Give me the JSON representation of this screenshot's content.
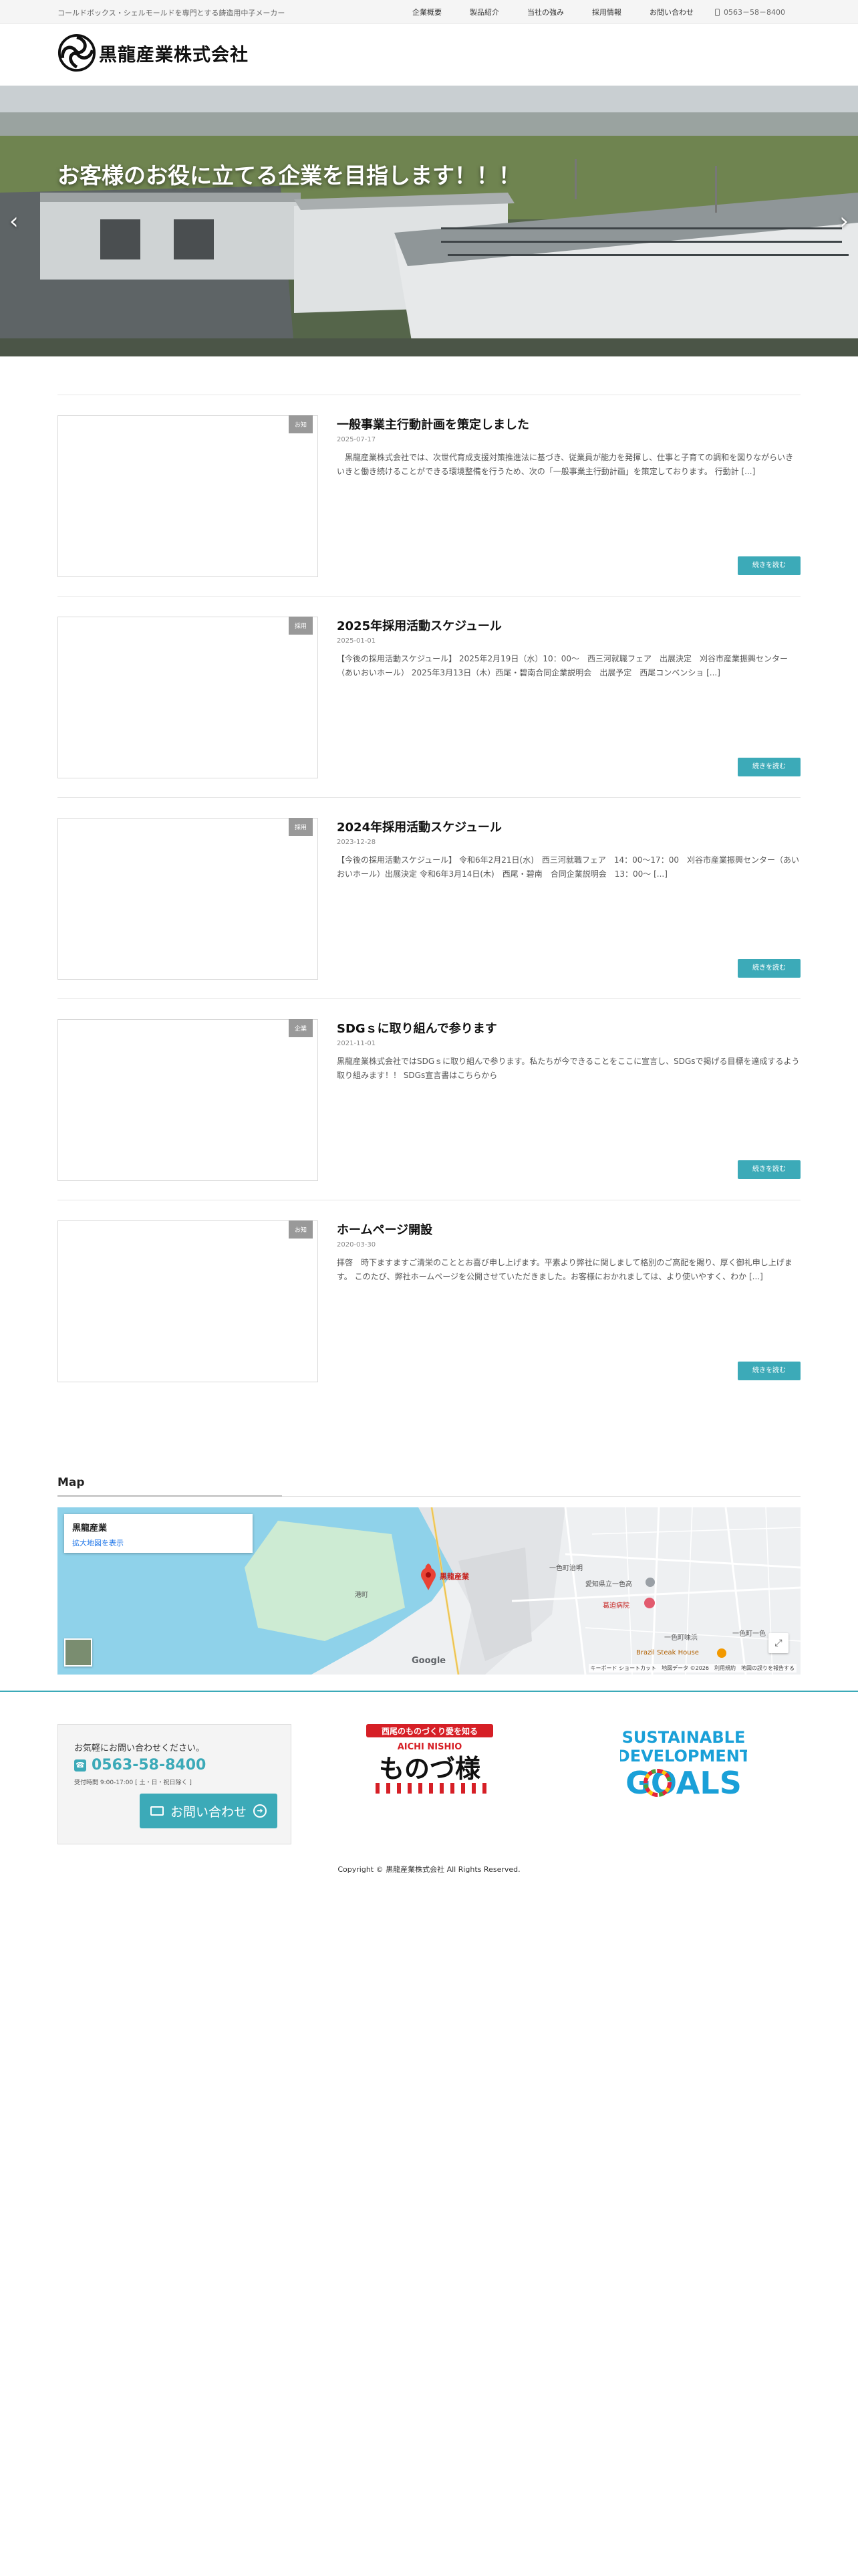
{
  "topbar": {
    "tagline": "コールドボックス・シェルモールドを専門とする鋳造用中子メーカー",
    "nav": [
      "企業概要",
      "製品紹介",
      "当社の強み",
      "採用情報",
      "お問い合わせ"
    ],
    "phone": "0563－58－8400"
  },
  "header": {
    "logo_text": "黒龍産業株式会社"
  },
  "hero": {
    "caption": "お客様のお役に立てる企業を目指します！！！"
  },
  "posts": [
    {
      "category": "お知",
      "title": "一般事業主行動計画を策定しました",
      "date": "2025-07-17",
      "excerpt": "　黒龍産業株式会社では、次世代育成支援対策推進法に基づき、従業員が能力を発揮し、仕事と子育ての調和を図りながらいきいきと働き続けることができる環境整備を行うため、次の「一般事業主行動計画」を策定しております。 行動計 [...]",
      "more": "続きを読む"
    },
    {
      "category": "採用",
      "title": "2025年採用活動スケジュール",
      "date": "2025-01-01",
      "excerpt": "【今後の採用活動スケジュール】 2025年2月19日（水）10：00〜　西三河就職フェア　出展決定　刈谷市産業振興センター（あいおいホール） 2025年3月13日（木）西尾・碧南合同企業説明会　出展予定　西尾コンベンショ [...]",
      "more": "続きを読む"
    },
    {
      "category": "採用",
      "title": "2024年採用活動スケジュール",
      "date": "2023-12-28",
      "excerpt": "【今後の採用活動スケジュール】 令和6年2月21日(水)　西三河就職フェア　14：00〜17：00　刈谷市産業振興センター（あいおいホール）出展決定 令和6年3月14日(木)　西尾・碧南　合同企業説明会　13：00〜 [...]",
      "more": "続きを読む"
    },
    {
      "category": "企業",
      "title": "SDGｓに取り組んで参ります",
      "date": "2021-11-01",
      "excerpt": "黒龍産業株式会社ではSDGｓに取り組んで参ります。私たちが今できることをここに宣言し、SDGsで掲げる目標を達成するよう取り組みます！！ SDGs宣言書はこちらから",
      "more": "続きを読む"
    },
    {
      "category": "お知",
      "title": "ホームページ開設",
      "date": "2020-03-30",
      "excerpt": "拝啓　時下ますますご清栄のこととお喜び申し上げます。平素より弊社に関しまして格別のご高配を賜り、厚く御礼申し上げます。 このたび、弊社ホームページを公開させていただきました。お客様におかれましては、より使いやすく、わか [...]",
      "more": "続きを読む"
    }
  ],
  "map": {
    "title": "Map",
    "place_name": "黒龍産業",
    "enlarge_link": "拡大地図を表示",
    "pin_label": "黒龍産業",
    "labels": {
      "town1": "一色町治明",
      "school": "愛知県立一色高",
      "hospital": "葛迫病院",
      "port": "港町",
      "town2": "一色町味浜",
      "town3": "一色町一色",
      "restaurant": "Brazil Steak House"
    },
    "google": "Google",
    "attribution": "キーボード ショートカット　地図データ ©2026　利用規約　地図の誤りを報告する"
  },
  "footer": {
    "contact_lead": "お気軽にお問い合わせください。",
    "contact_phone": "0563-58-8400",
    "contact_hours": "受付時間 9:00-17:00 [ 土・日・祝日除く ]",
    "contact_button": "お問い合わせ",
    "monodukuri": {
      "top": "西尾のものづくり愛を知る",
      "sub": "AICHI NISHIO",
      "main": "ものづ様"
    },
    "sdgs": {
      "line1": "SUSTAINABLE",
      "line2": "DEVELOPMENT",
      "line3": "GOALS"
    },
    "copyright": "Copyright © 黒龍産業株式会社 All Rights Reserved."
  },
  "colors": {
    "accent": "#3caab8",
    "category_badge": "#999999"
  }
}
